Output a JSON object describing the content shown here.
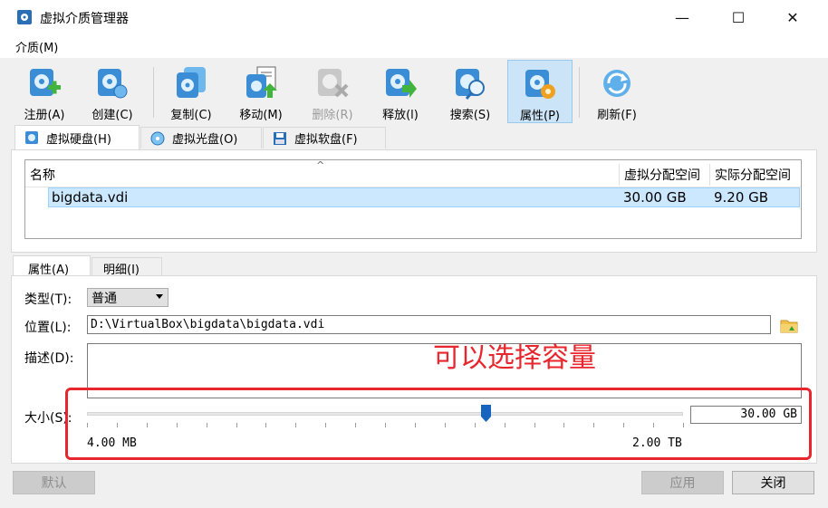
{
  "window": {
    "title": "虚拟介质管理器",
    "minimize": "—",
    "maximize": "☐",
    "close": "✕"
  },
  "menu": {
    "item": "介质(M)"
  },
  "toolbar": [
    {
      "label": "注册(A)",
      "icon": "register-icon"
    },
    {
      "label": "创建(C)",
      "icon": "create-icon"
    },
    {
      "label": "复制(C)",
      "icon": "copy-icon"
    },
    {
      "label": "移动(M)",
      "icon": "move-icon"
    },
    {
      "label": "删除(R)",
      "icon": "delete-icon",
      "disabled": true
    },
    {
      "label": "释放(l)",
      "icon": "release-icon"
    },
    {
      "label": "搜索(S)",
      "icon": "search-icon"
    },
    {
      "label": "属性(P)",
      "icon": "properties-icon",
      "active": true
    },
    {
      "label": "刷新(F)",
      "icon": "refresh-icon"
    }
  ],
  "media_tabs": [
    {
      "label": "虚拟硬盘(H)",
      "selected": true
    },
    {
      "label": "虚拟光盘(O)"
    },
    {
      "label": "虚拟软盘(F)"
    }
  ],
  "list": {
    "sort_indicator": "^",
    "columns": [
      "名称",
      "虚拟分配空间",
      "实际分配空间"
    ],
    "rows": [
      {
        "name": "bigdata.vdi",
        "virtual": "30.00 GB",
        "actual": "9.20 GB"
      }
    ]
  },
  "detail_tabs": [
    "属性(A)",
    "明细(I)"
  ],
  "properties": {
    "type_label": "类型(T):",
    "type_value": "普通",
    "location_label": "位置(L):",
    "location_value": "D:\\VirtualBox\\bigdata\\bigdata.vdi",
    "description_label": "描述(D):",
    "size_label": "大小(S):",
    "size_value": "30.00 GB",
    "size_min": "4.00 MB",
    "size_max": "2.00 TB",
    "slider_fraction": 0.67
  },
  "annotation": "可以选择容量",
  "buttons": {
    "reset": "默认",
    "apply": "应用",
    "close": "关闭"
  },
  "colors": {
    "accent": "#cce4f7",
    "selection": "#cce8ff",
    "annotation": "#e8262d",
    "thumb": "#1565c0"
  }
}
